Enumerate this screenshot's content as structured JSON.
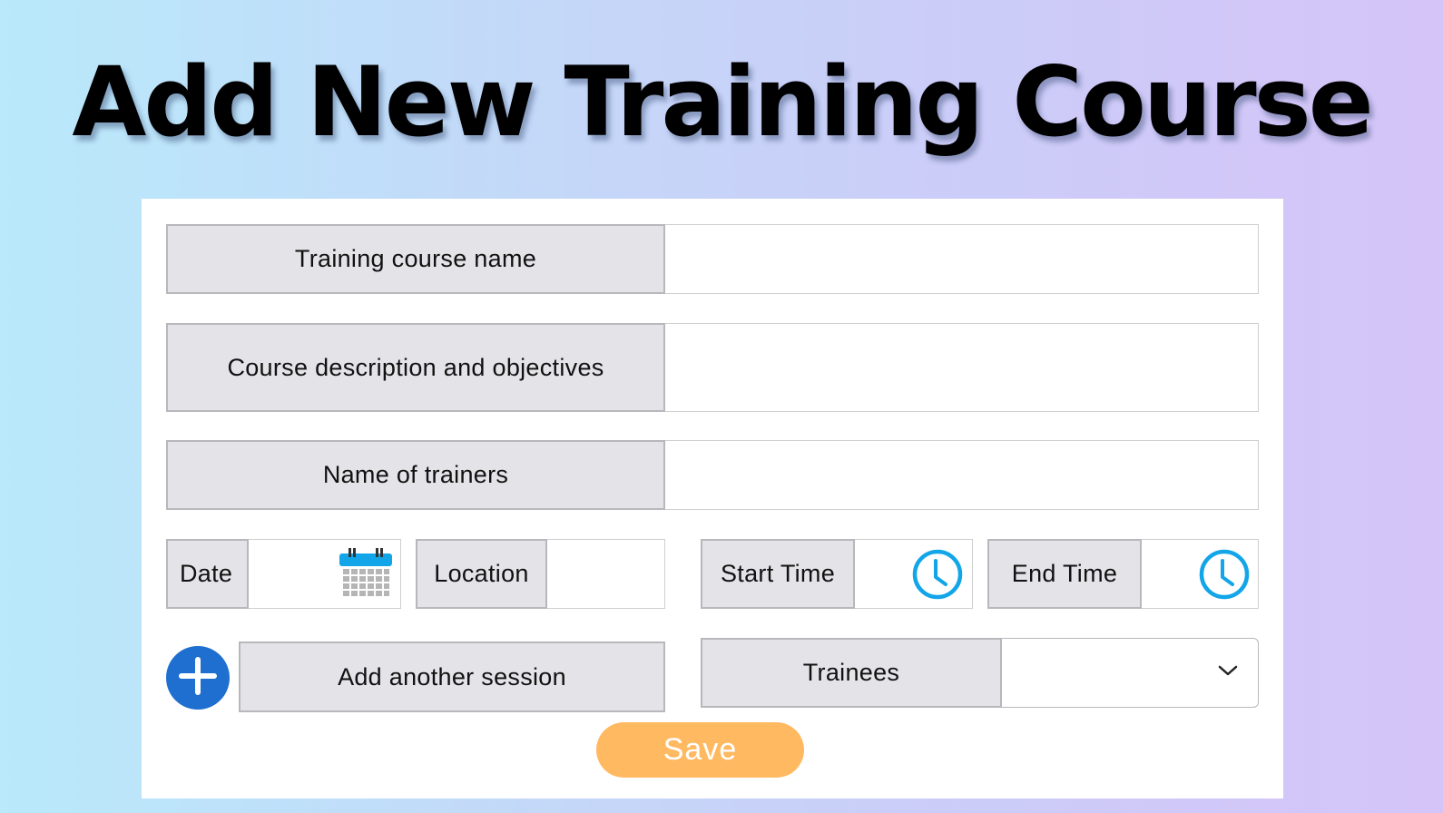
{
  "page": {
    "title": "Add New Training Course"
  },
  "form": {
    "course_name": {
      "label": "Training course name",
      "value": ""
    },
    "description": {
      "label": "Course description and objectives",
      "value": ""
    },
    "trainers": {
      "label": "Name of trainers",
      "value": ""
    },
    "date": {
      "label": "Date",
      "value": "",
      "icon": "calendar-icon"
    },
    "location": {
      "label": "Location",
      "value": ""
    },
    "start_time": {
      "label": "Start Time",
      "value": "",
      "icon": "clock-icon"
    },
    "end_time": {
      "label": "End Time",
      "value": "",
      "icon": "clock-icon"
    },
    "add_session": {
      "label": "Add another session",
      "icon": "plus-circle-icon"
    },
    "trainees": {
      "label": "Trainees",
      "selected": "",
      "icon": "chevron-down-icon"
    },
    "save_label": "Save"
  },
  "colors": {
    "accent_blue": "#1f6fd0",
    "icon_blue": "#12a5e8",
    "save_orange": "#ffb961",
    "label_bg": "#e4e4e8"
  }
}
